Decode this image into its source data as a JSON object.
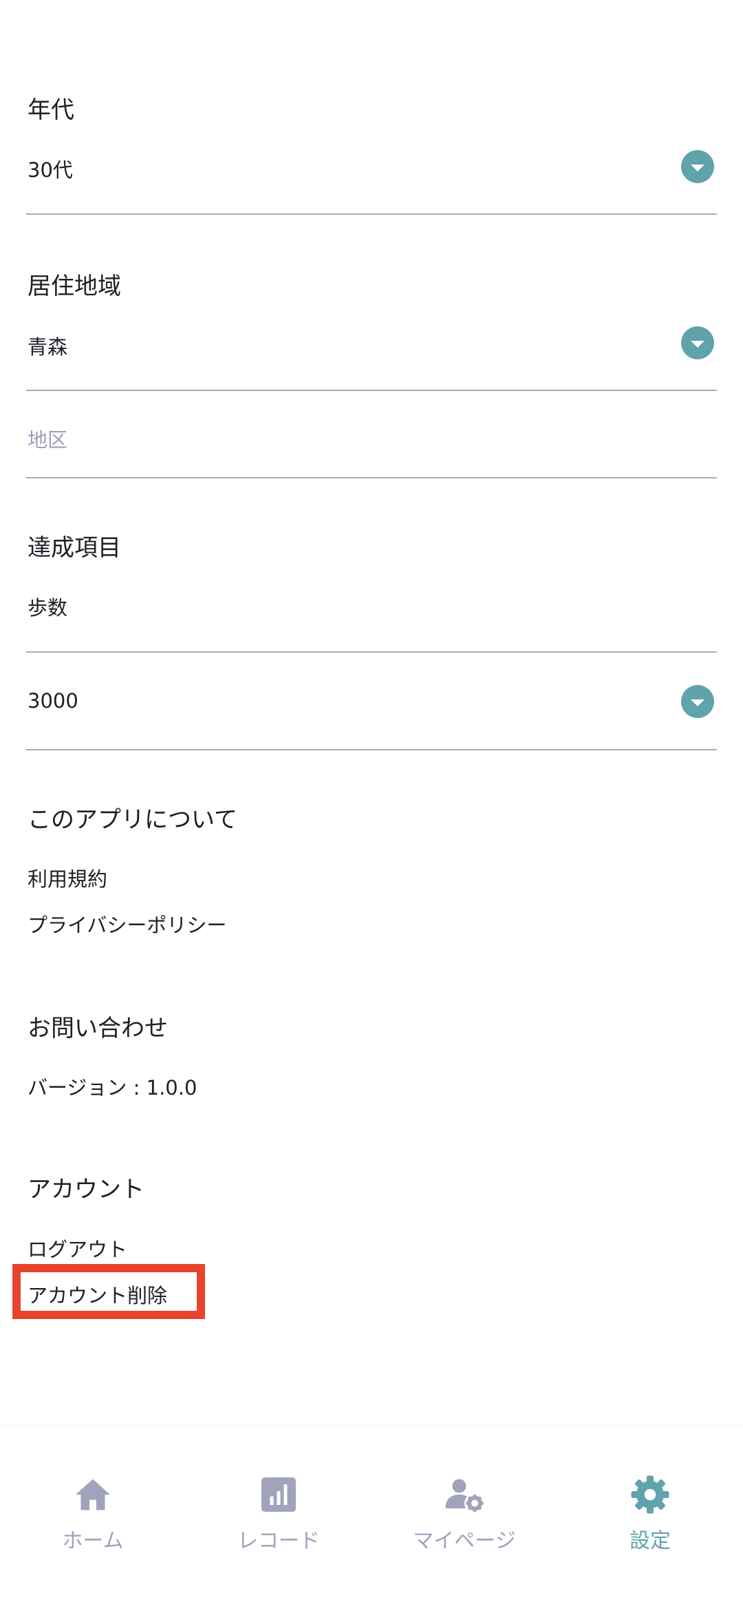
{
  "age": {
    "label": "年代",
    "value": "30代"
  },
  "residence": {
    "label": "居住地域",
    "value": "青森",
    "district_placeholder": "地区"
  },
  "goal": {
    "label": "達成項目",
    "item": "歩数",
    "value": "3000"
  },
  "about": {
    "label": "このアプリについて",
    "terms": "利用規約",
    "privacy": "プライバシーポリシー"
  },
  "contact": {
    "label": "お問い合わせ",
    "version": "バージョン : 1.0.0"
  },
  "account": {
    "label": "アカウント",
    "logout": "ログアウト",
    "delete": "アカウント削除"
  },
  "colors": {
    "accent": "#5fa3ac",
    "inactive": "#a1a3bd",
    "highlight": "#e8432c"
  },
  "nav": {
    "items": [
      {
        "label": "ホーム",
        "icon": "home-icon"
      },
      {
        "label": "レコード",
        "icon": "chart-icon"
      },
      {
        "label": "マイページ",
        "icon": "user-settings-icon"
      },
      {
        "label": "設定",
        "icon": "gear-icon",
        "active": true
      }
    ]
  }
}
